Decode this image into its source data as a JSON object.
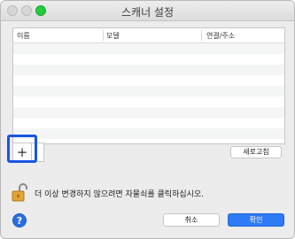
{
  "window": {
    "title": "스캐너 설정"
  },
  "table": {
    "headers": [
      "이름",
      "모델",
      "연결/주소"
    ],
    "row_count": 12
  },
  "buttons": {
    "add_label": "+",
    "refresh_label": "새로고침",
    "cancel_label": "취소",
    "ok_label": "확인",
    "help_label": "?"
  },
  "lock": {
    "message": "더 이상 변경하지 않으려면 자물쇠를 클릭하십시오."
  },
  "colors": {
    "accent": "#2f7bf5",
    "highlight": "#1a55e3",
    "maximize": "#27c93f"
  }
}
